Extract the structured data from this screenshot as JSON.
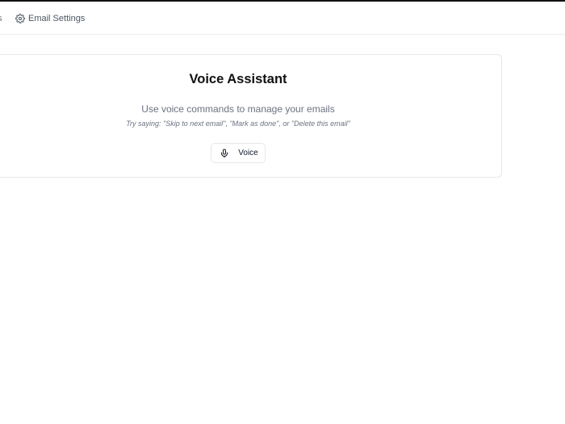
{
  "topbar": {
    "prev_tab_fragment": "s",
    "settings_link": {
      "icon": "gear-icon",
      "label": "Email Settings"
    }
  },
  "voice_card": {
    "title": "Voice Assistant",
    "subtitle": "Use voice commands to manage your emails",
    "hint": "Try saying: \"Skip to next email\", \"Mark as done\", or \"Delete this email\"",
    "button": {
      "icon": "microphone-icon",
      "label": "Voice"
    }
  },
  "colors": {
    "border": "#e8e8e8",
    "muted_text": "#6b7280",
    "title_text": "#111111"
  }
}
